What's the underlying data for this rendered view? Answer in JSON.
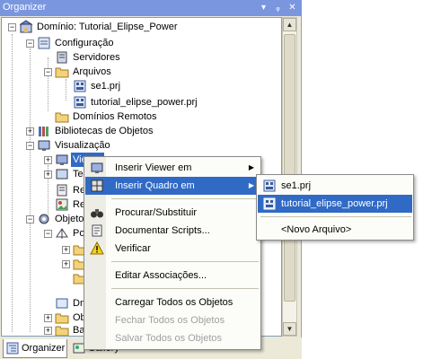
{
  "panel": {
    "title": "Organizer",
    "pin_glyph": "▾",
    "autohide_glyph": "ᵩ",
    "close_glyph": "✕"
  },
  "tree": {
    "root": "Domínio: Tutorial_Elipse_Power",
    "configuracao": "Configuração",
    "servidores": "Servidores",
    "arquivos": "Arquivos",
    "se1": "se1.prj",
    "tutorial_prj": "tutorial_elipse_power.prj",
    "dominios_remotos": "Domínios Remotos",
    "bibliotecas": "Bibliotecas de Objetos",
    "visualizacao": "Visualização",
    "viewer_partial": "Viewer",
    "tel_partial": "Tel",
    "re1_partial": "Re",
    "re2_partial": "Re",
    "objetos_partial": "Objetos",
    "pow_partial": "Pow",
    "dm_partial": "Dm",
    "ob_partial": "Ob",
    "ba_partial": "Ba"
  },
  "tabs": [
    {
      "label": "Organizer",
      "icon": "organizer-icon"
    },
    {
      "label": "Gallery",
      "icon": "gallery-icon"
    }
  ],
  "context_menu": {
    "items": [
      {
        "label": "Inserir Viewer em",
        "icon": "viewer-icon",
        "submenu": true
      },
      {
        "label": "Inserir Quadro em",
        "icon": "frame-icon",
        "submenu": true
      },
      {
        "label": "Procurar/Substituir",
        "icon": "binoculars-icon"
      },
      {
        "label": "Documentar Scripts...",
        "icon": "document-icon"
      },
      {
        "label": "Verificar",
        "icon": "warning-icon"
      },
      {
        "label": "Editar Associações..."
      },
      {
        "label": "Carregar Todos os Objetos"
      },
      {
        "label": "Fechar Todos os Objetos",
        "disabled": true
      },
      {
        "label": "Salvar Todos os Objetos",
        "disabled": true
      }
    ],
    "arrow": "▶"
  },
  "submenu": {
    "items": [
      {
        "label": "se1.prj"
      },
      {
        "label": "tutorial_elipse_power.prj"
      },
      {
        "label": "<Novo Arquivo>"
      }
    ]
  },
  "colors": {
    "selection": "#316ac5",
    "titlebar": "#7a96df",
    "panel_bg": "#ece9d8"
  }
}
